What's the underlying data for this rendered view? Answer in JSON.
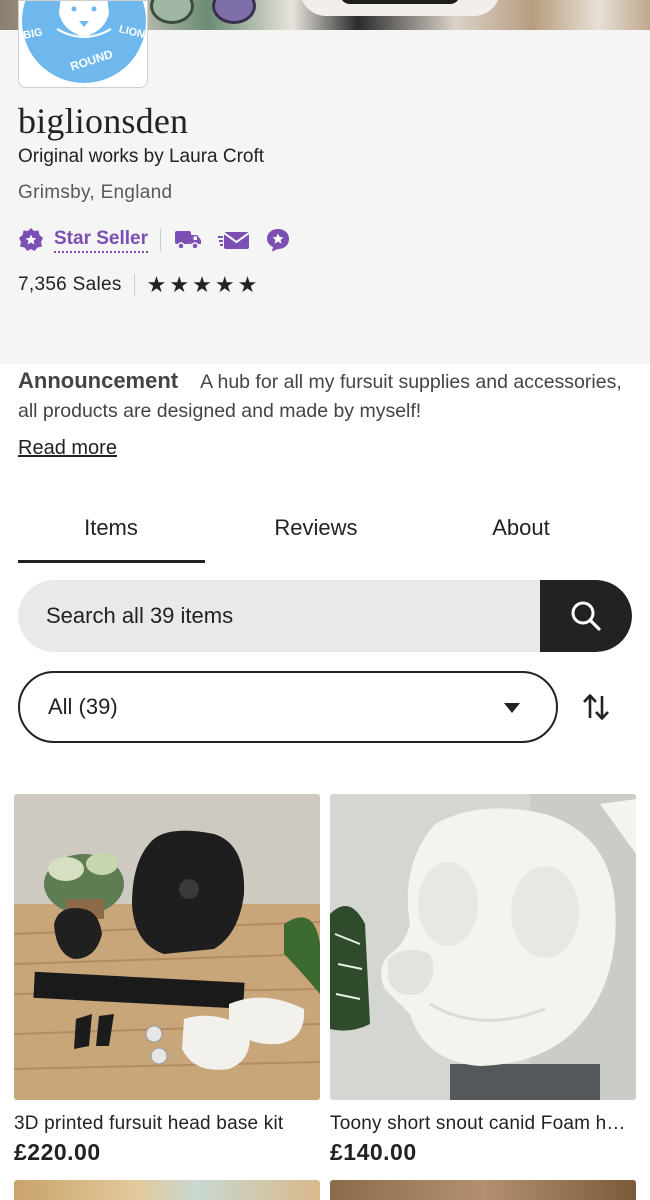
{
  "shop": {
    "name": "biglionsden",
    "tagline": "Original works by Laura Croft",
    "location": "Grimsby, England",
    "star_seller_label": "Star Seller",
    "sales": "7,356 Sales",
    "rating_stars": 5,
    "logo_text": [
      "BIG",
      "LION",
      "ROUND"
    ]
  },
  "announcement": {
    "title": "Announcement",
    "text": "A hub for all my fursuit supplies and accessories, all products are designed and made by myself!",
    "read_more": "Read more"
  },
  "tabs": [
    {
      "label": "Items",
      "active": true
    },
    {
      "label": "Reviews",
      "active": false
    },
    {
      "label": "About",
      "active": false
    }
  ],
  "search": {
    "placeholder": "Search all 39 items"
  },
  "filter": {
    "selected": "All (39)"
  },
  "listings": [
    {
      "title": "3D printed fursuit head base kit",
      "price": "£220.00"
    },
    {
      "title": "Toony short snout canid Foam head base",
      "price": "£140.00"
    }
  ],
  "colors": {
    "accent_purple": "#7b4fb3",
    "logo_blue": "#6fb8ee",
    "text_dark": "#222222"
  },
  "icons": [
    "star-seller-icon",
    "shipping-truck-icon",
    "fast-reply-message-icon",
    "star-badge-icon",
    "star-icon",
    "search-icon",
    "caret-down-icon",
    "sort-icon"
  ]
}
